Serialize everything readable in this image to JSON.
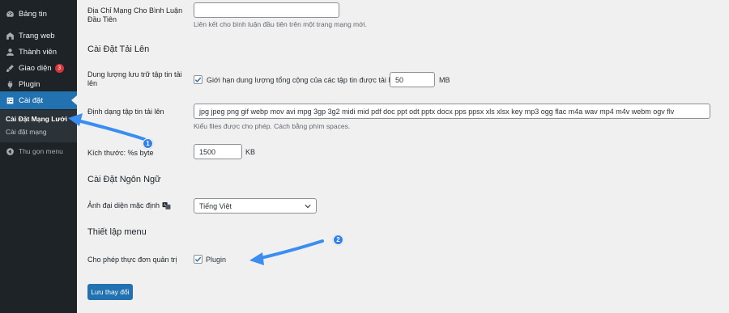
{
  "sidebar": {
    "items": [
      {
        "label": "Bảng tin",
        "icon": "dashboard-icon"
      },
      {
        "label": "Trang web",
        "icon": "sites-icon"
      },
      {
        "label": "Thành viên",
        "icon": "users-icon"
      },
      {
        "label": "Giao diện",
        "icon": "appearance-icon",
        "badge": "3"
      },
      {
        "label": "Plugin",
        "icon": "plugin-icon"
      },
      {
        "label": "Cài đặt",
        "icon": "settings-icon",
        "active": true
      }
    ],
    "submenu": [
      "Cài Đặt Mạng Lưới",
      "Cài đặt mạng"
    ],
    "collapse_label": "Thu gọn menu"
  },
  "form": {
    "comment_url": {
      "label": "Địa Chỉ Mạng Cho Bình Luận Đầu Tiên",
      "value": "",
      "description": "Liên kết cho bình luận đầu tiên trên một trang mạng mới."
    },
    "upload_heading": "Cài Đặt Tải Lên",
    "upload_quota": {
      "label": "Dung lượng lưu trữ tập tin tải lên",
      "checkbox_label": "Giới hạn dung lượng tổng cộng của các tập tin được tải lên là",
      "checked": true,
      "value": "50",
      "unit": "MB"
    },
    "upload_filetypes": {
      "label": "Định dạng tập tin tải lên",
      "value": "jpg jpeg png gif webp mov avi mpg 3gp 3g2 midi mid pdf doc ppt odt pptx docx pps ppsx xls xlsx key mp3 ogg flac m4a wav mp4 m4v webm ogv flv",
      "description": "Kiểu files được cho phép. Cách bằng phím spaces."
    },
    "max_size": {
      "label": "Kích thước: %s byte",
      "value": "1500",
      "unit": "KB"
    },
    "language_heading": "Cài Đặt Ngôn Ngữ",
    "language": {
      "label": "Ảnh đại diện mặc định",
      "selected": "Tiếng Việt"
    },
    "menu_heading": "Thiết lập menu",
    "menu_settings": {
      "label": "Cho phép thực đơn quản trị",
      "checkbox_label": "Plugin",
      "checked": true
    },
    "save_label": "Lưu thay đổi"
  },
  "annotations": [
    "1",
    "2"
  ],
  "colors": {
    "sidebar_bg": "#1d2327",
    "accent": "#2271b1",
    "badge": "#d63638",
    "annotation": "#2f80ed"
  }
}
